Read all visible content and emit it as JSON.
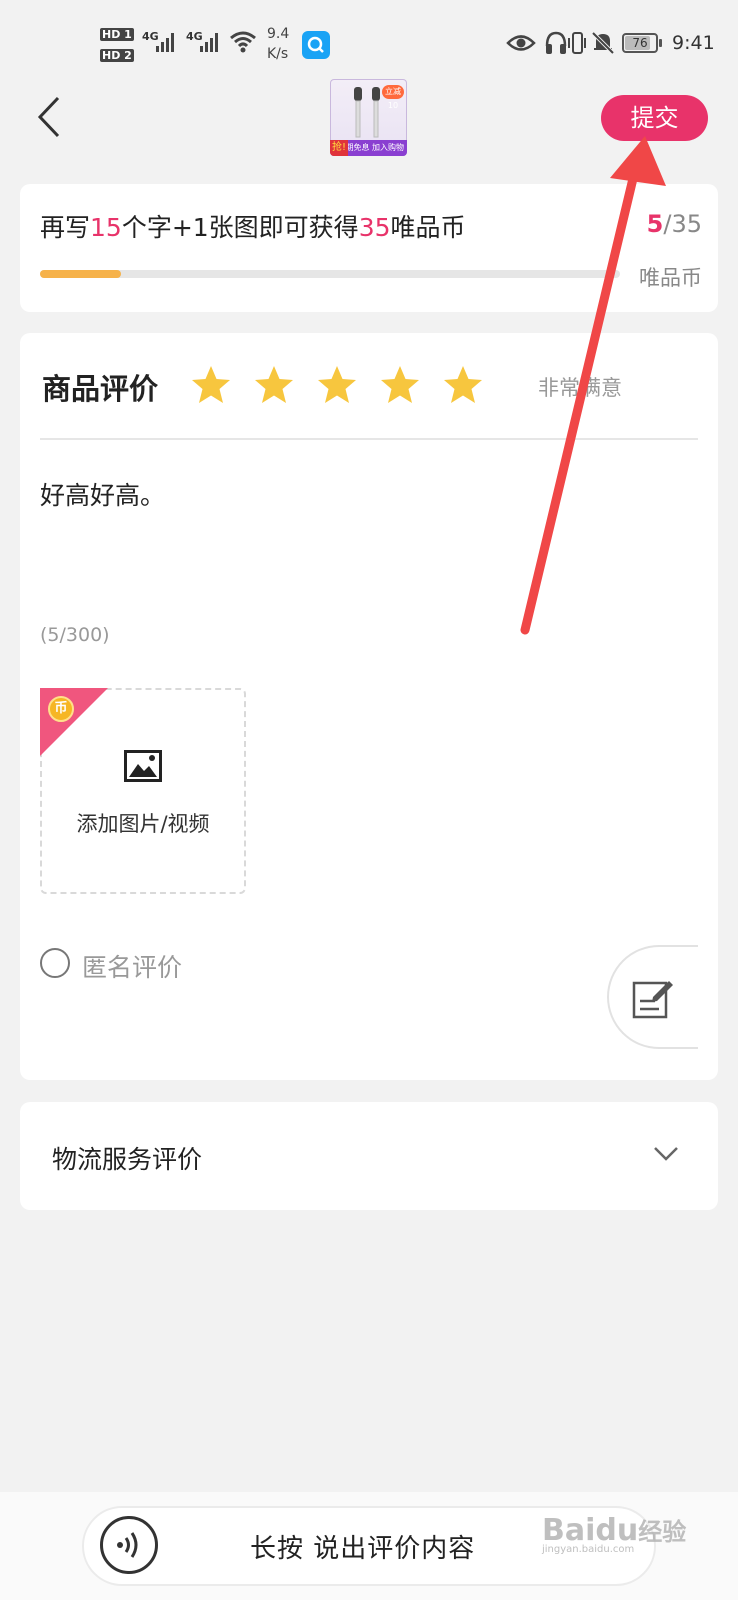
{
  "status_bar": {
    "hd1": "HD 1",
    "hd2": "HD 2",
    "net1": "4G",
    "net2": "4G",
    "speed_value": "9.4",
    "speed_unit": "K/s",
    "battery": "76",
    "time": "9:41",
    "icons": [
      "signal-icon",
      "wifi-icon",
      "search-app-icon",
      "eye-icon",
      "headphones-icon",
      "vibrate-icon",
      "mute-bell-icon",
      "battery-icon"
    ]
  },
  "header": {
    "submit_label": "提交",
    "product_thumb": {
      "tag": "抢!",
      "banner": "分期免息 加入购物",
      "badge": "立减10"
    }
  },
  "reward_card": {
    "prefix": "再写",
    "chars_needed": "15",
    "middle": "个字+1张图即可获得",
    "coins": "35",
    "suffix": "唯品币",
    "progress_current": "5",
    "progress_total": "/35",
    "unit_label": "唯品币",
    "progress_fraction": 0.14
  },
  "review": {
    "title": "商品评价",
    "rating": 5,
    "rating_max": 5,
    "rating_label": "非常满意",
    "text": "好高好高。",
    "char_count": "(5/300)",
    "upload_label": "添加图片/视频",
    "coin_glyph": "币",
    "anonymous_label": "匿名评价"
  },
  "logistics": {
    "title": "物流服务评价"
  },
  "voice": {
    "label": "长按 说出评价内容"
  },
  "watermark": {
    "brand": "Baidu",
    "cn": "经验",
    "url": "jingyan.baidu.com"
  },
  "colors": {
    "accent": "#e8336a",
    "star": "#f7c63e",
    "progress": "#f6b24a",
    "annotation_arrow": "#f04747"
  }
}
